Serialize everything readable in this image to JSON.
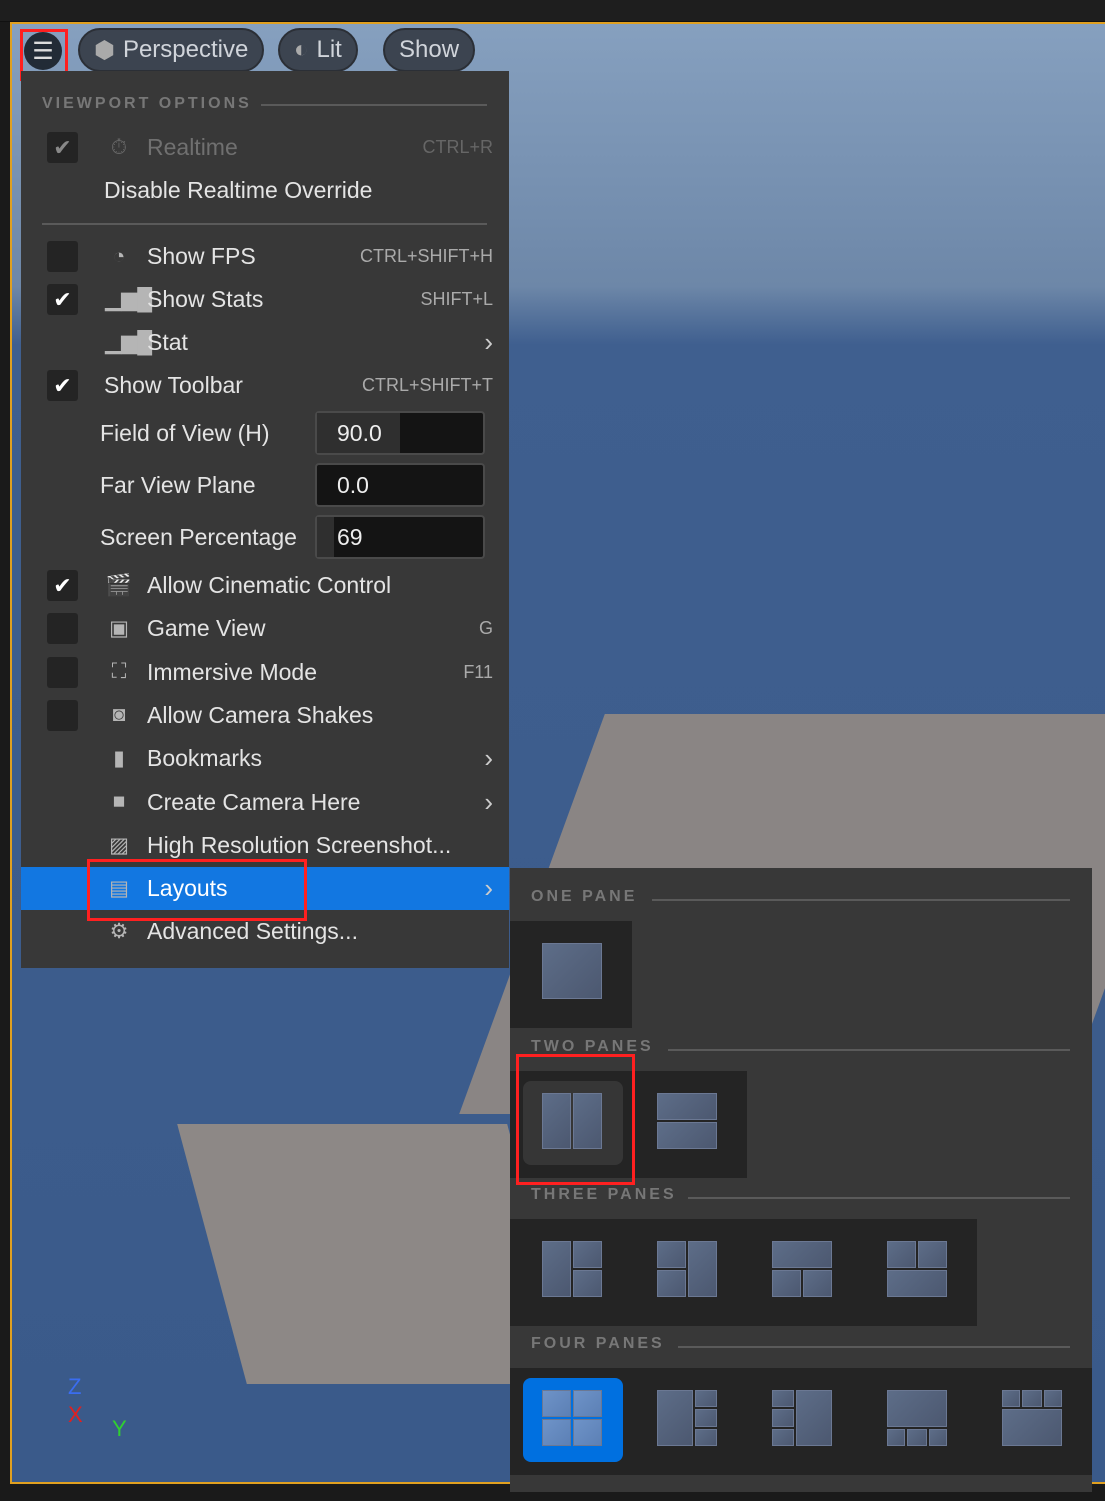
{
  "toolbar": {
    "menu_icon": "hamburger-icon",
    "perspective": "Perspective",
    "lit": "Lit",
    "show": "Show"
  },
  "menu": {
    "header": "VIEWPORT OPTIONS",
    "realtime": {
      "label": "Realtime",
      "shortcut": "CTRL+R",
      "checked": true,
      "disabled": true
    },
    "disable_override": "Disable Realtime Override",
    "items": [
      {
        "label": "Show FPS",
        "shortcut": "CTRL+SHIFT+H",
        "checked": false,
        "icon": "speedometer-icon"
      },
      {
        "label": "Show Stats",
        "shortcut": "SHIFT+L",
        "checked": true,
        "icon": "bar-chart-icon"
      },
      {
        "label": "Stat",
        "submenu": true,
        "icon": "bar-chart-icon"
      },
      {
        "label": "Show Toolbar",
        "shortcut": "CTRL+SHIFT+T",
        "checked": true
      }
    ],
    "fields": [
      {
        "label": "Field of View (H)",
        "value": "90.0",
        "fill_percent": 50
      },
      {
        "label": "Far View Plane",
        "value": "0.0",
        "fill_percent": 0
      },
      {
        "label": "Screen Percentage",
        "value": "69",
        "fill_percent": 10
      }
    ],
    "items2": [
      {
        "label": "Allow Cinematic Control",
        "checked": true,
        "icon": "clapperboard-icon"
      },
      {
        "label": "Game View",
        "shortcut": "G",
        "checked": false,
        "icon": "gamepad-icon"
      },
      {
        "label": "Immersive Mode",
        "shortcut": "F11",
        "checked": false,
        "icon": "fullscreen-icon"
      },
      {
        "label": "Allow Camera Shakes",
        "checked": false,
        "icon": "camera-shake-icon"
      },
      {
        "label": "Bookmarks",
        "submenu": true,
        "icon": "bookmark-icon"
      },
      {
        "label": "Create Camera Here",
        "submenu": true,
        "icon": "camera-add-icon"
      },
      {
        "label": "High Resolution Screenshot...",
        "icon": "screenshot-icon"
      },
      {
        "label": "Layouts",
        "submenu": true,
        "highlighted": true,
        "icon": "layout-icon"
      },
      {
        "label": "Advanced Settings...",
        "icon": "gear-icon"
      }
    ]
  },
  "layouts": {
    "sections": [
      {
        "title": "ONE PANE",
        "options": [
          "one-pane"
        ]
      },
      {
        "title": "TWO PANES",
        "options": [
          "two-panes-horizontal",
          "two-panes-vertical"
        ]
      },
      {
        "title": "THREE PANES",
        "options": [
          "three-panes-left",
          "three-panes-right",
          "three-panes-top",
          "three-panes-bottom"
        ]
      },
      {
        "title": "FOUR PANES",
        "options": [
          "four-panes-2x2",
          "four-panes-left",
          "four-panes-right",
          "four-panes-top",
          "four-panes-bottom"
        ]
      }
    ],
    "selected": "four-panes-2x2",
    "hovered": "two-panes-horizontal"
  },
  "axes": {
    "z": "Z",
    "x": "X",
    "y": "Y"
  },
  "colors": {
    "accent": "#1277e1",
    "highlight_box": "#ff2020",
    "viewport_border": "#e0a020"
  }
}
